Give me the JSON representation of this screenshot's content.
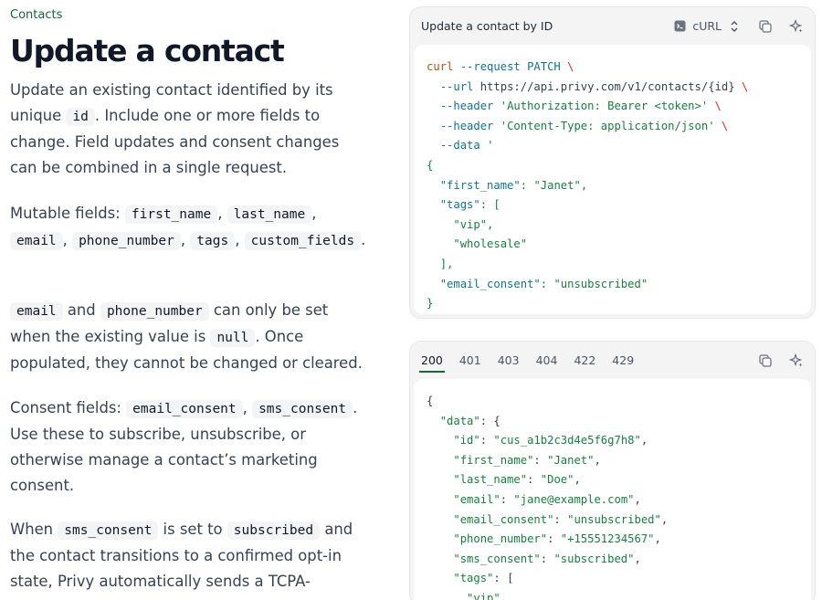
{
  "breadcrumb": "Contacts",
  "title": "Update a contact",
  "intro": {
    "t1": "Update an existing contact identified by its unique",
    "code1": "id",
    "t2": ". Include one or more fields to change. Field updates and consent changes can be combined in a single request."
  },
  "mutable": {
    "label": "Mutable fields:",
    "fields": [
      "first_name",
      "last_name",
      "email",
      "phone_number",
      "tags",
      "custom_fields"
    ]
  },
  "immutable": {
    "code1": "email",
    "t1": "and",
    "code2": "phone_number",
    "t2": "can only be set when the existing value is",
    "code3": "null",
    "t3": ". Once populated, they cannot be changed or cleared."
  },
  "consent": {
    "label": "Consent fields:",
    "code1": "email_consent",
    "code2": "sms_consent",
    "t1": ". Use these to subscribe, unsubscribe, or otherwise manage a contact’s marketing consent."
  },
  "sms": {
    "t1": "When",
    "code1": "sms_consent",
    "t2": "is set to",
    "code2": "subscribed",
    "t3": "and the contact transitions to a confirmed opt-in state, Privy automatically sends a TCPA-"
  },
  "request_panel": {
    "title": "Update a contact by ID",
    "language": "cURL",
    "code": {
      "cmd": "curl",
      "l1": "--request PATCH",
      "url_flag": "--url",
      "url": "https://api.privy.com/v1/contacts/{id}",
      "header_flag": "--header",
      "auth": "'Authorization: Bearer <token>'",
      "ctype": "'Content-Type: application/json'",
      "data_flag": "--data",
      "data_q": "'",
      "first_name_key": "\"first_name\"",
      "first_name_val": "\"Janet\"",
      "tags_key": "\"tags\"",
      "tag1": "\"vip\"",
      "tag2": "\"wholesale\"",
      "email_consent_key": "\"email_consent\"",
      "email_consent_val": "\"unsubscribed\""
    }
  },
  "response_panel": {
    "tabs": [
      "200",
      "401",
      "403",
      "404",
      "422",
      "429"
    ],
    "active_tab": "200",
    "code": {
      "data_key": "\"data\"",
      "id_key": "\"id\"",
      "id_val": "\"cus_a1b2c3d4e5f6g7h8\"",
      "first_name_key": "\"first_name\"",
      "first_name_val": "\"Janet\"",
      "last_name_key": "\"last_name\"",
      "last_name_val": "\"Doe\"",
      "email_key": "\"email\"",
      "email_val": "\"jane@example.com\"",
      "email_consent_key": "\"email_consent\"",
      "email_consent_val": "\"unsubscribed\"",
      "phone_key": "\"phone_number\"",
      "phone_val": "\"+15551234567\"",
      "sms_key": "\"sms_consent\"",
      "sms_val": "\"subscribed\"",
      "tags_key": "\"tags\"",
      "tag1": "\"vip\""
    }
  },
  "colors": {
    "accent": "#166534",
    "code_bg": "#f3f4f6",
    "panel_bg": "#f4f4f5"
  },
  "icons": [
    "terminal-icon",
    "chevron-updown-icon",
    "copy-icon",
    "sparkle-icon"
  ]
}
